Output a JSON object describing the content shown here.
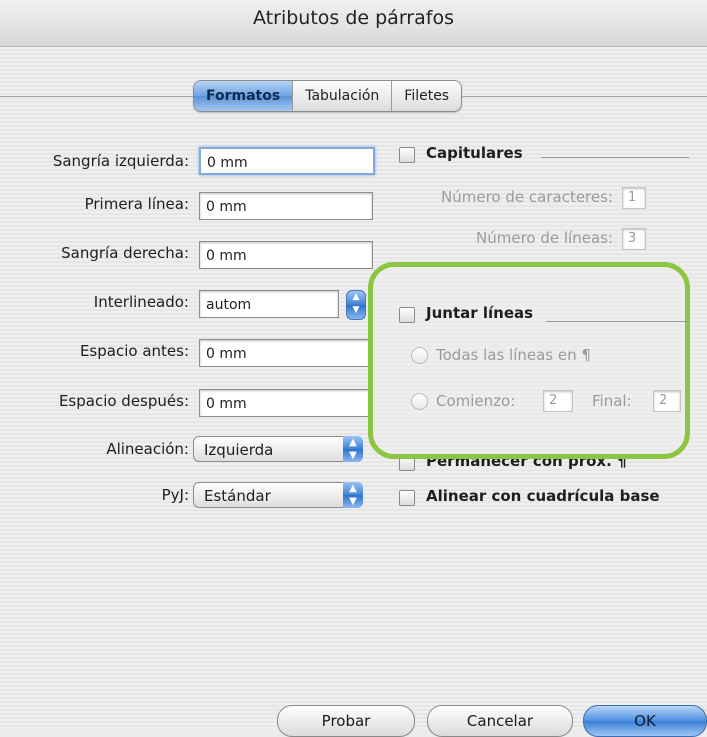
{
  "dialog": {
    "title": "Atributos de párrafos"
  },
  "tabs": [
    {
      "label": "Formatos",
      "active": true
    },
    {
      "label": "Tabulación",
      "active": false
    },
    {
      "label": "Filetes",
      "active": false
    }
  ],
  "left_fields": {
    "left_indent": {
      "label": "Sangría izquierda:",
      "value": "0 mm"
    },
    "first_line": {
      "label": "Primera línea:",
      "value": "0 mm"
    },
    "right_indent": {
      "label": "Sangría derecha:",
      "value": "0 mm"
    },
    "leading": {
      "label": "Interlineado:",
      "value": "autom"
    },
    "space_before": {
      "label": "Espacio antes:",
      "value": "0 mm"
    },
    "space_after": {
      "label": "Espacio después:",
      "value": "0 mm"
    },
    "alignment": {
      "label": "Alineación:",
      "value": "Izquierda"
    },
    "hj": {
      "label": "PyJ:",
      "value": "Estándar"
    }
  },
  "drop_caps": {
    "label": "Capitulares",
    "char_count": {
      "label": "Número de caracteres:",
      "value": "1"
    },
    "line_count": {
      "label": "Número de líneas:",
      "value": "3"
    }
  },
  "keep_lines": {
    "label": "Juntar líneas",
    "all_lines_label": "Todas las líneas en ¶",
    "start_label": "Comienzo:",
    "start_value": "2",
    "end_label": "Final:",
    "end_value": "2"
  },
  "keep_with_next": {
    "label": "Permanecer con próx. ¶"
  },
  "baseline_grid": {
    "label": "Alinear con cuadrícula base"
  },
  "buttons": {
    "apply": "Probar",
    "cancel": "Cancelar",
    "ok": "OK"
  },
  "colors": {
    "highlight": "#8cc53f",
    "accent": "#3b7fd6"
  },
  "icons": {
    "stepper": "up-down-arrows-icon",
    "popup": "popup-arrows-icon"
  }
}
